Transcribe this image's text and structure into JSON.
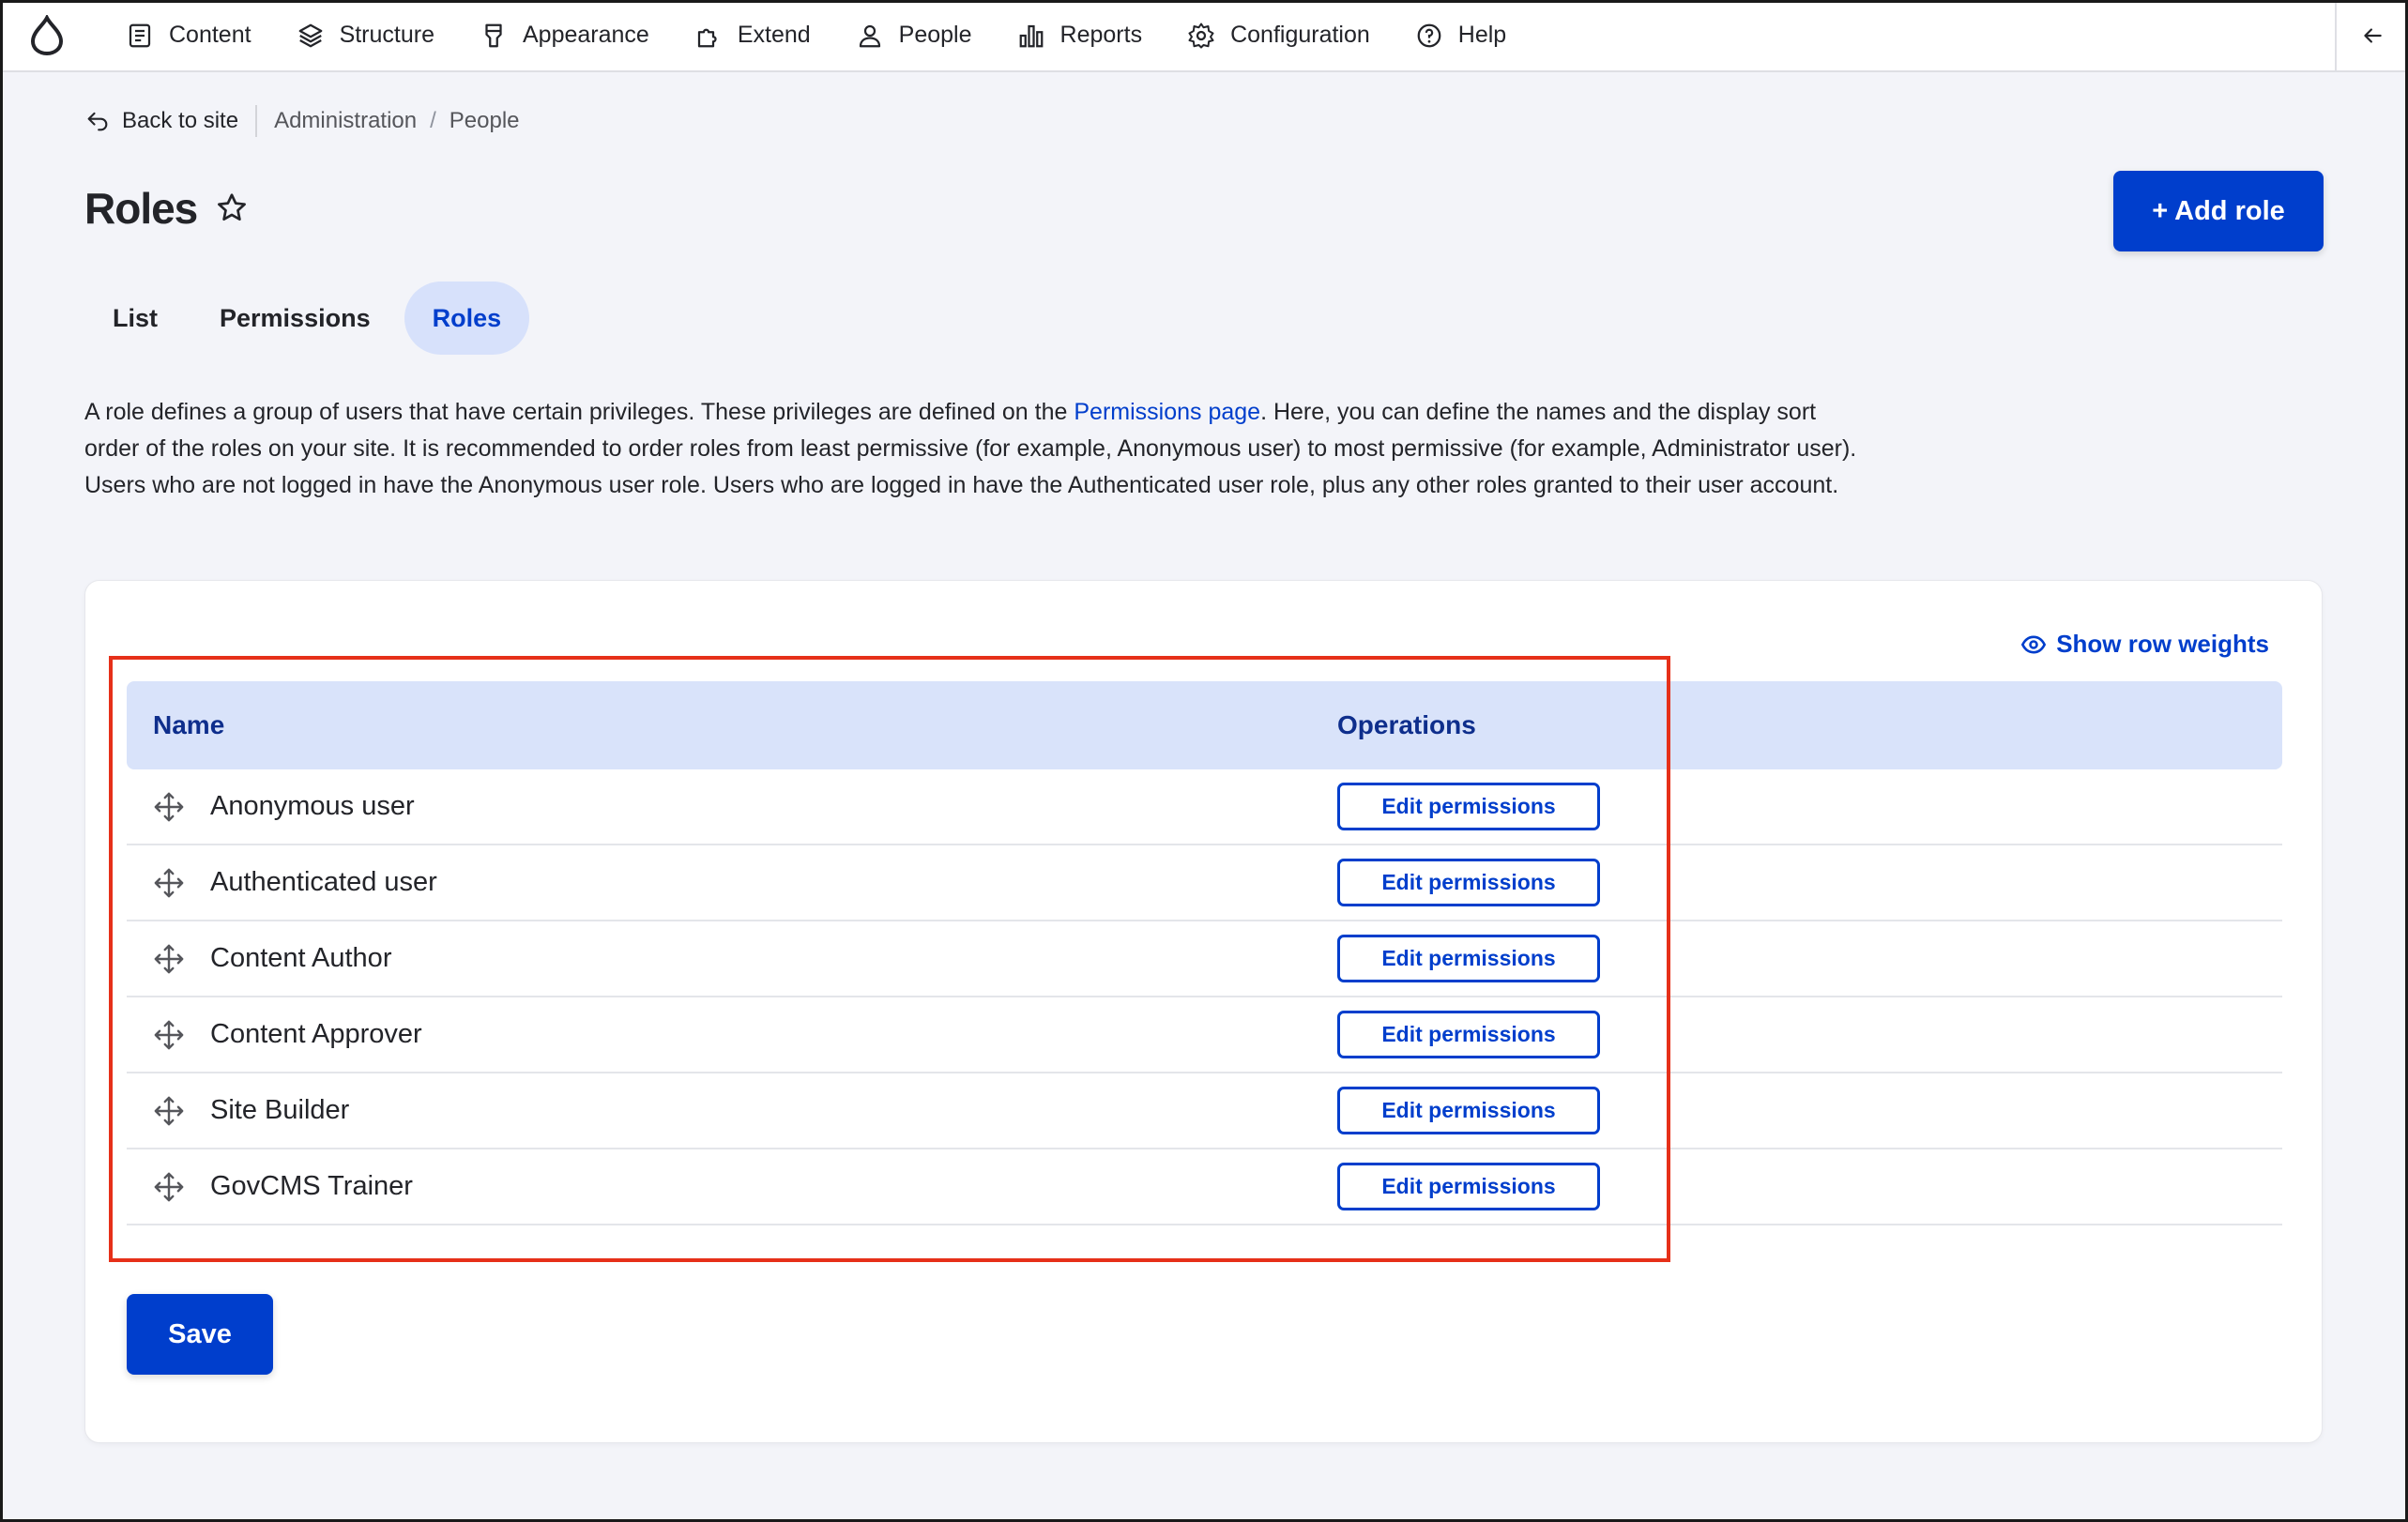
{
  "toolbar": {
    "items": [
      {
        "label": "Content",
        "icon": "document-icon"
      },
      {
        "label": "Structure",
        "icon": "layers-icon"
      },
      {
        "label": "Appearance",
        "icon": "brush-icon"
      },
      {
        "label": "Extend",
        "icon": "puzzle-icon"
      },
      {
        "label": "People",
        "icon": "person-icon"
      },
      {
        "label": "Reports",
        "icon": "bar-chart-icon"
      },
      {
        "label": "Configuration",
        "icon": "gear-icon"
      },
      {
        "label": "Help",
        "icon": "help-circle-icon"
      }
    ]
  },
  "breadcrumb": {
    "back": "Back to site",
    "items": [
      "Administration",
      "People"
    ]
  },
  "page": {
    "title": "Roles",
    "add_button": "+ Add role"
  },
  "tabs": [
    {
      "label": "List",
      "active": false
    },
    {
      "label": "Permissions",
      "active": false
    },
    {
      "label": "Roles",
      "active": true
    }
  ],
  "description": {
    "before_link": "A role defines a group of users that have certain privileges. These privileges are defined on the ",
    "link": "Permissions page",
    "after_link": ". Here, you can define the names and the display sort order of the roles on your site. It is recommended to order roles from least permissive (for example, Anonymous user) to most permissive (for example, Administrator user). Users who are not logged in have the Anonymous user role. Users who are logged in have the Authenticated user role, plus any other roles granted to their user account."
  },
  "table": {
    "show_weights": "Show row weights",
    "headers": {
      "name": "Name",
      "operations": "Operations"
    },
    "rows": [
      {
        "name": "Anonymous user",
        "op": "Edit permissions"
      },
      {
        "name": "Authenticated user",
        "op": "Edit permissions"
      },
      {
        "name": "Content Author",
        "op": "Edit permissions"
      },
      {
        "name": "Content Approver",
        "op": "Edit permissions"
      },
      {
        "name": "Site Builder",
        "op": "Edit permissions"
      },
      {
        "name": "GovCMS Trainer",
        "op": "Edit permissions"
      }
    ],
    "save": "Save"
  },
  "colors": {
    "primary": "#003ecc",
    "highlight": "#e63019"
  }
}
